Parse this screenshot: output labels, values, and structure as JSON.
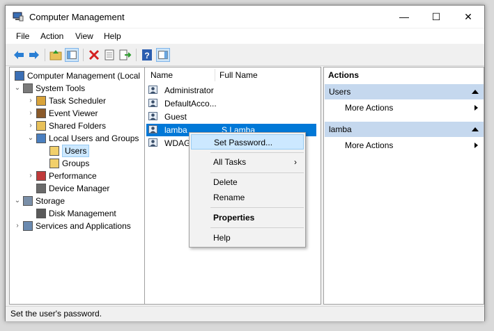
{
  "window": {
    "title": "Computer Management",
    "minimize_glyph": "—",
    "maximize_glyph": "☐",
    "close_glyph": "✕"
  },
  "menu": [
    "File",
    "Action",
    "View",
    "Help"
  ],
  "toolbar": {
    "icons": [
      "back-icon",
      "forward-icon",
      "up-folder-icon",
      "show-hide-tree-icon",
      "delete-icon",
      "properties-icon",
      "export-list-icon",
      "help-icon",
      "show-hide-action-pane-icon"
    ]
  },
  "tree": [
    {
      "label": "Computer Management (Local",
      "icon": "computer-management-icon",
      "expand": ""
    },
    {
      "label": "System Tools",
      "icon": "system-tools-icon",
      "expand": "⌄"
    },
    {
      "label": "Task Scheduler",
      "icon": "clock-icon",
      "expand": "›"
    },
    {
      "label": "Event Viewer",
      "icon": "event-viewer-icon",
      "expand": "›"
    },
    {
      "label": "Shared Folders",
      "icon": "shared-folder-icon",
      "expand": "›"
    },
    {
      "label": "Local Users and Groups",
      "icon": "users-groups-icon",
      "expand": "⌄"
    },
    {
      "label": "Users",
      "icon": "folder-icon",
      "expand": ""
    },
    {
      "label": "Groups",
      "icon": "folder-icon",
      "expand": ""
    },
    {
      "label": "Performance",
      "icon": "performance-icon",
      "expand": "›"
    },
    {
      "label": "Device Manager",
      "icon": "device-manager-icon",
      "expand": ""
    },
    {
      "label": "Storage",
      "icon": "storage-icon",
      "expand": "⌄"
    },
    {
      "label": "Disk Management",
      "icon": "disk-icon",
      "expand": ""
    },
    {
      "label": "Services and Applications",
      "icon": "services-icon",
      "expand": "›"
    }
  ],
  "list": {
    "columns": [
      "Name",
      "Full Name"
    ],
    "rows": [
      {
        "name": "Administrator",
        "full_name": ""
      },
      {
        "name": "DefaultAcco...",
        "full_name": ""
      },
      {
        "name": "Guest",
        "full_name": ""
      },
      {
        "name": "lamba",
        "full_name": "S Lamba"
      },
      {
        "name": "WDAGU",
        "full_name": ""
      }
    ]
  },
  "actions": {
    "header": "Actions",
    "groups": [
      {
        "title": "Users",
        "item": "More Actions"
      },
      {
        "title": "lamba",
        "item": "More Actions"
      }
    ]
  },
  "context_menu": {
    "set_password": "Set Password...",
    "all_tasks": "All Tasks",
    "submenu_glyph": "›",
    "delete": "Delete",
    "rename": "Rename",
    "properties": "Properties",
    "help": "Help"
  },
  "status": "Set the user's password.",
  "colors": {
    "selection": "#0078d7",
    "menu_highlight": "#cce8ff",
    "action_group": "#c5d8ee"
  }
}
